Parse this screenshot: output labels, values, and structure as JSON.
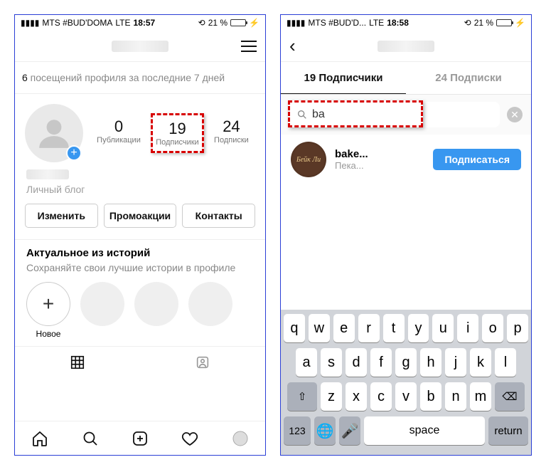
{
  "phone1": {
    "statusbar": {
      "carrier": "MTS #BUD'DOMA",
      "network": "LTE",
      "time": "18:57",
      "battery": "21 %"
    },
    "visits": {
      "count": "6",
      "text": " посещений профиля за последние 7 дней"
    },
    "stats": {
      "posts": {
        "count": "0",
        "label": "Публикации"
      },
      "followers": {
        "count": "19",
        "label": "Подписчики"
      },
      "following": {
        "count": "24",
        "label": "Подписки"
      }
    },
    "bio": {
      "category": "Личный блог"
    },
    "buttons": {
      "edit": "Изменить",
      "promo": "Промоакции",
      "contacts": "Контакты"
    },
    "stories": {
      "title": "Актуальное из историй",
      "subtitle": "Сохраняйте свои лучшие истории в профиле",
      "new_label": "Новое"
    }
  },
  "phone2": {
    "statusbar": {
      "carrier": "MTS #BUD'D...",
      "network": "LTE",
      "time": "18:58",
      "battery": "21 %"
    },
    "tabs": {
      "followers": "19 Подписчики",
      "following": "24 Подписки"
    },
    "search": {
      "value": "ba"
    },
    "result": {
      "name": "bake...",
      "subtitle": "Пека...",
      "button": "Подписаться"
    },
    "keyboard": {
      "row1": [
        "q",
        "w",
        "e",
        "r",
        "t",
        "y",
        "u",
        "i",
        "o",
        "p"
      ],
      "row2": [
        "a",
        "s",
        "d",
        "f",
        "g",
        "h",
        "j",
        "k",
        "l"
      ],
      "row3": [
        "z",
        "x",
        "c",
        "v",
        "b",
        "n",
        "m"
      ],
      "special": {
        "num": "123",
        "space": "space",
        "return": "return"
      }
    }
  }
}
